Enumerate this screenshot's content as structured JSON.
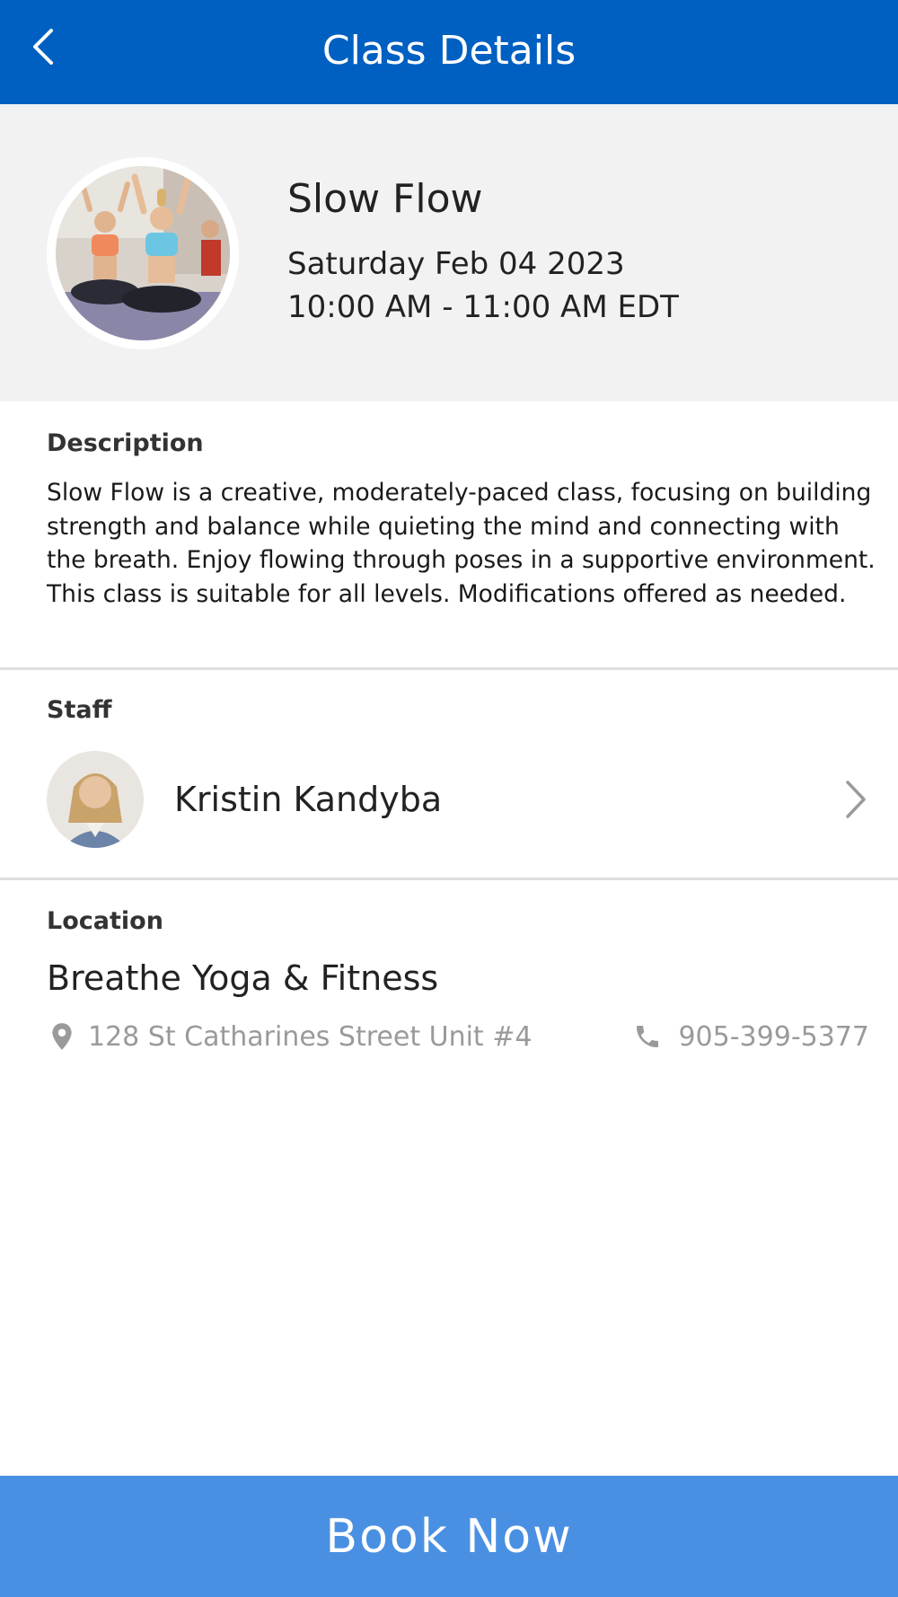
{
  "header": {
    "title": "Class Details",
    "back_icon": "chevron-left-icon"
  },
  "class_info": {
    "name": "Slow Flow",
    "date": "Saturday Feb 04 2023",
    "time": "10:00 AM - 11:00 AM EDT"
  },
  "description": {
    "label": "Description",
    "text": "Slow Flow is a creative, moderately-paced class, focusing on building strength and balance while quieting the mind and connecting with the breath. Enjoy flowing through poses in a supportive environment. This class is suitable for all levels. Modifications offered as needed."
  },
  "staff": {
    "label": "Staff",
    "name": "Kristin Kandyba"
  },
  "location": {
    "label": "Location",
    "name": "Breathe Yoga & Fitness",
    "address": "128 St Catharines Street Unit #4",
    "phone": "905-399-5377"
  },
  "actions": {
    "book_label": "Book Now"
  },
  "colors": {
    "header_bg": "#0060c1",
    "book_button_bg": "#4a90e2",
    "hero_bg": "#f2f2f2",
    "muted_text": "#9a9a9a"
  }
}
